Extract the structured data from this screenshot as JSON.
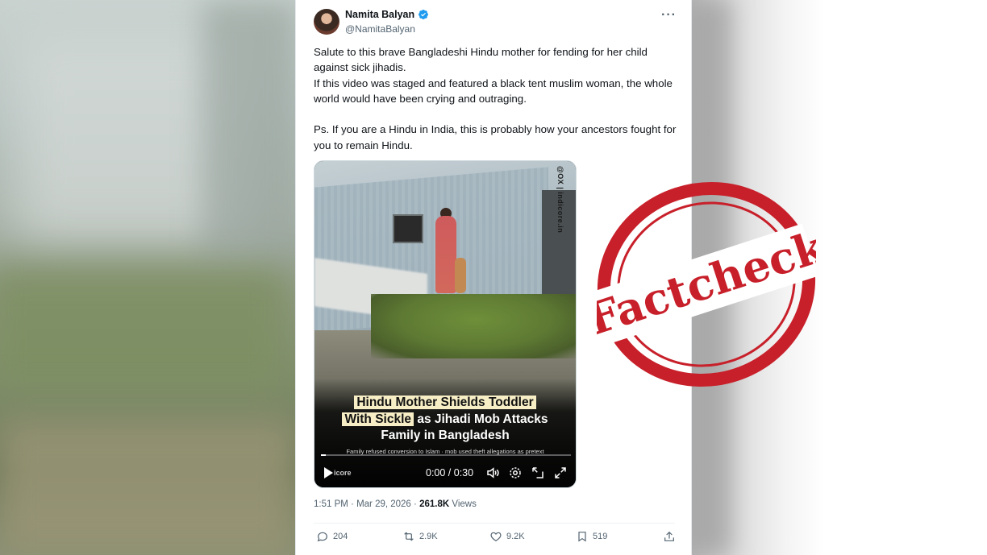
{
  "author": {
    "name": "Namita Balyan",
    "handle": "@NamitaBalyan"
  },
  "more_label": "···",
  "tweet": {
    "text": "Salute to this brave Bangladeshi Hindu mother for fending for her child against sick jihadis.\nIf this video was staged and featured a black tent muslim woman, the whole world would have been crying and outraging.\n\nPs. If you are a Hindu in India, this is probably how your ancestors fought for you to remain Hindu."
  },
  "video": {
    "watermark": "@OX | indicore.in",
    "headline_line1": "Hindu Mother Shields Toddler",
    "headline_line2_highlight": "With Sickle",
    "headline_line2_rest": " as Jihadi Mob Attacks",
    "headline_line3": "Family in Bangladesh",
    "subcaption": "Family refused conversion to Islam · mob used theft allegations as pretext",
    "brand": "icore",
    "time": "0:00 / 0:30",
    "progress": 0.02
  },
  "meta": {
    "time": "1:51 PM",
    "sep1": " · ",
    "date": "Mar 29, 2026",
    "sep2": " · ",
    "views_count": "261.8K",
    "views_label": " Views"
  },
  "actions": {
    "replies": "204",
    "reposts": "2.9K",
    "likes": "9.2K",
    "bookmarks": "519"
  },
  "stamp": {
    "text": "Factcheck",
    "color": "#c8202a"
  },
  "colors": {
    "verified": "#1d9bf0",
    "text": "#0f1419",
    "muted": "#536471"
  },
  "icons": [
    "verified-badge-icon",
    "more-icon",
    "play-icon",
    "volume-icon",
    "settings-icon",
    "pip-icon",
    "fullscreen-icon",
    "reply-icon",
    "repost-icon",
    "like-icon",
    "bookmark-icon",
    "share-icon"
  ]
}
